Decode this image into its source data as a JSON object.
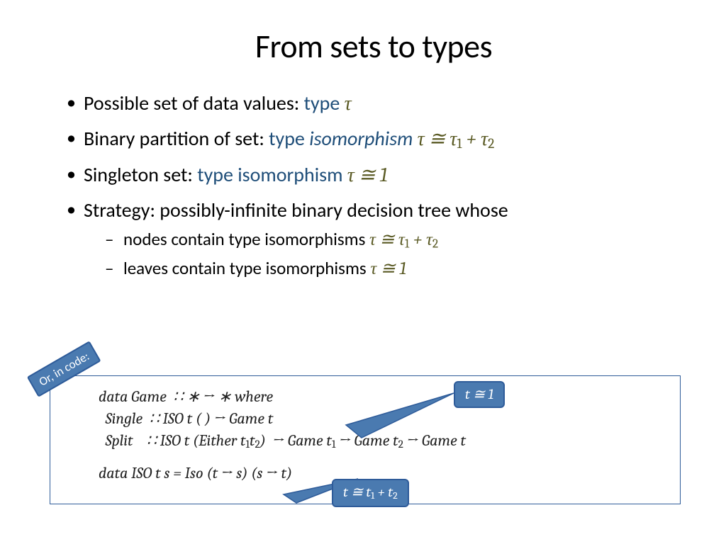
{
  "title": "From sets to types",
  "bullets": {
    "b1_text": "Possible set of data values: ",
    "b1_blue": "type ",
    "b1_math": "τ",
    "b2_text": "Binary partition of set: ",
    "b2_blue": "type ",
    "b2_ital": "isomorphism ",
    "b2_math": "τ ≅ τ",
    "b2_plus": " + τ",
    "b3_text": "Singleton set: ",
    "b3_blue": "type isomorphism ",
    "b3_math": "τ ≅ 1",
    "b4_text": "Strategy: possibly-infinite binary decision tree whose",
    "s1_text": "nodes contain type isomorphisms ",
    "s1_math": "τ ≅ τ",
    "s1_plus": " + τ",
    "s2_text": "leaves contain type isomorphisms ",
    "s2_math": "τ ≅ 1",
    "sub1": "1",
    "sub2": "2"
  },
  "tag": "Or, in code:",
  "code": {
    "l1": "data Game  ∷ ∗ → ∗ where",
    "l2a": "  Single  ∷ ISO t ( ) → Game t",
    "l3a": "  Split    ∷ ISO t (Either t",
    "l3b": "t",
    "l3c": ")  → Game t",
    "l3d": " → Game t",
    "l3e": " → Game t",
    "l4": "data ISO t s = Iso (t → s) (s → t)"
  },
  "callouts": {
    "c1": "t ≅ 1",
    "c2a": "t ≅ t",
    "c2b": " + t"
  }
}
